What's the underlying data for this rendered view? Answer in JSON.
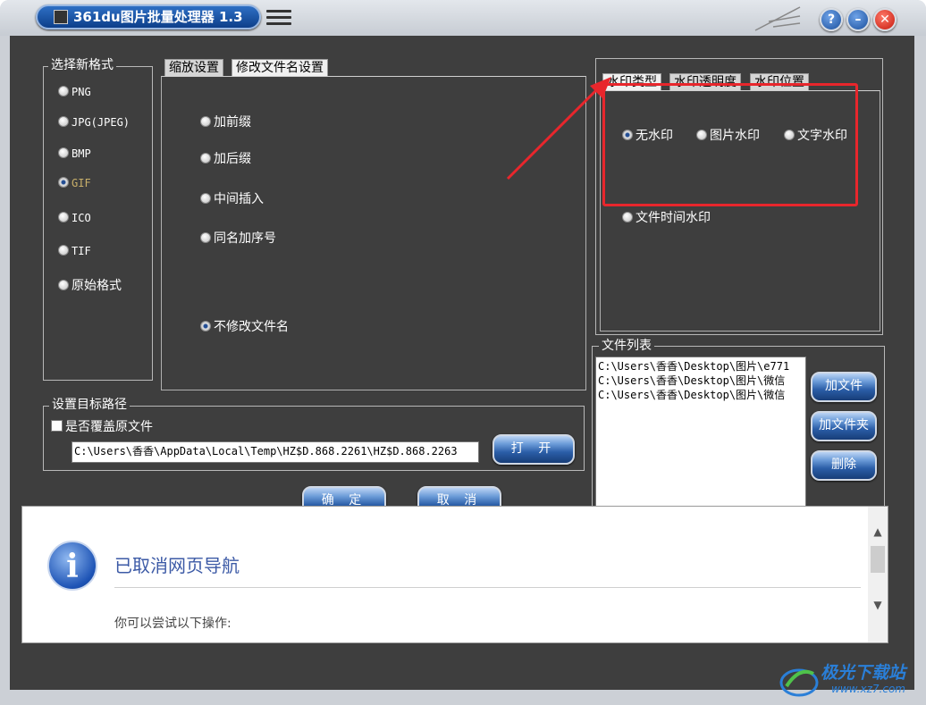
{
  "window": {
    "title": "361du图片批量处理器 1.3"
  },
  "format_group": {
    "label": "选择新格式",
    "options": [
      "PNG",
      "JPG(JPEG)",
      "BMP",
      "GIF",
      "ICO",
      "TIF",
      "原始格式"
    ],
    "selected": "GIF"
  },
  "rename_tabs": {
    "tab1": "缩放设置",
    "tab2": "修改文件名设置",
    "options": [
      "加前缀",
      "加后缀",
      "中间插入",
      "同名加序号",
      "不修改文件名"
    ],
    "selected": "不修改文件名"
  },
  "watermark_tabs": {
    "tab1": "水印类型",
    "tab2": "水印透明度",
    "tab3": "水印位置",
    "options": [
      "无水印",
      "图片水印",
      "文字水印",
      "文件时间水印"
    ],
    "selected": "无水印"
  },
  "target": {
    "label": "设置目标路径",
    "overwrite_label": "是否覆盖原文件",
    "path": "C:\\Users\\香香\\AppData\\Local\\Temp\\HZ$D.868.2261\\HZ$D.868.2263",
    "open_button": "打 开"
  },
  "actions": {
    "ok": "确 定",
    "cancel": "取 消"
  },
  "file_list": {
    "label": "文件列表",
    "items": [
      "C:\\Users\\香香\\Desktop\\图片\\e771",
      "C:\\Users\\香香\\Desktop\\图片\\微信",
      "C:\\Users\\香香\\Desktop\\图片\\微信"
    ],
    "add_file": "加文件",
    "add_folder": "加文件夹",
    "delete": "删除"
  },
  "browser": {
    "title": "已取消网页导航",
    "subtitle": "你可以尝试以下操作:"
  },
  "watermark_logo": {
    "text": "极光下载站",
    "url": "www.xz7.com"
  },
  "colors": {
    "annotation_red": "#e8262c",
    "client_bg": "#3e3e3e"
  }
}
